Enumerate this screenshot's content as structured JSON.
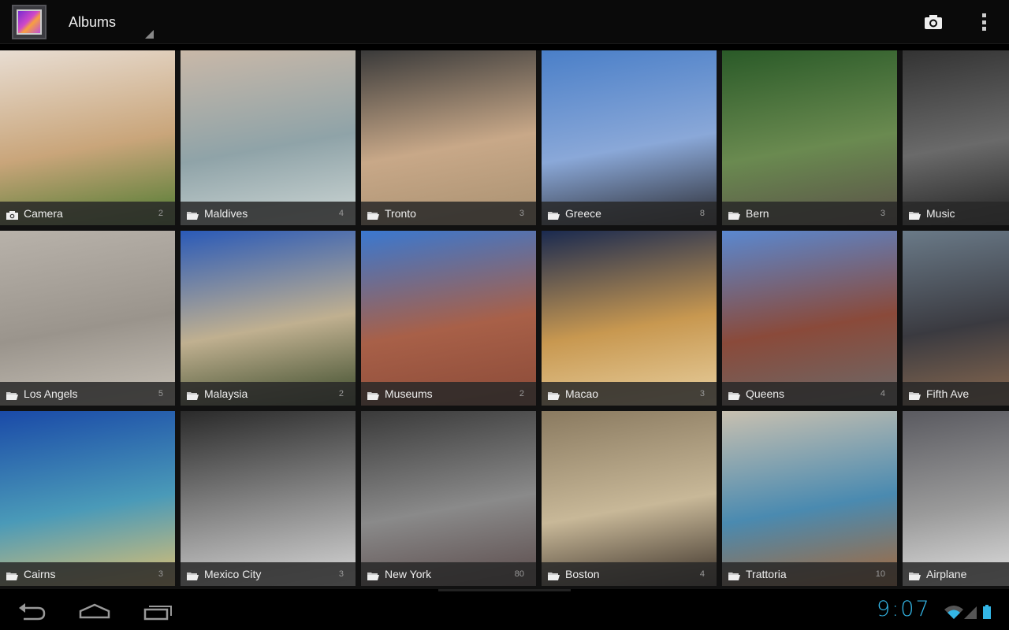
{
  "actionbar": {
    "title": "Albums"
  },
  "status": {
    "time": "9:07"
  },
  "albums": [
    {
      "name": "Camera",
      "count": "2",
      "icon": "camera-icon",
      "colors": [
        "#e8ddd2",
        "#c9a57a",
        "#4d7a30"
      ]
    },
    {
      "name": "Maldives",
      "count": "4",
      "icon": "folder-icon",
      "colors": [
        "#c9b8a8",
        "#8fa3a8",
        "#cfd8d6"
      ]
    },
    {
      "name": "Tronto",
      "count": "3",
      "icon": "folder-icon",
      "colors": [
        "#3a3a3a",
        "#c8a888",
        "#a89070"
      ]
    },
    {
      "name": "Greece",
      "count": "8",
      "icon": "folder-icon",
      "colors": [
        "#4a7fc8",
        "#8aa8d8",
        "#2a2a30"
      ]
    },
    {
      "name": "Bern",
      "count": "3",
      "icon": "folder-icon",
      "colors": [
        "#2a5a28",
        "#6a8a50",
        "#5a5048"
      ]
    },
    {
      "name": "Music",
      "count": "",
      "icon": "folder-icon",
      "colors": [
        "#333",
        "#6a6a6a",
        "#222"
      ]
    },
    {
      "name": "Los Angels",
      "count": "5",
      "icon": "folder-icon",
      "colors": [
        "#b8b2aa",
        "#9a948c",
        "#c8c2b8"
      ]
    },
    {
      "name": "Malaysia",
      "count": "2",
      "icon": "folder-icon",
      "colors": [
        "#2a5ab8",
        "#c0b090",
        "#3a4a2a"
      ]
    },
    {
      "name": "Museums",
      "count": "2",
      "icon": "folder-icon",
      "colors": [
        "#3a78d0",
        "#a86048",
        "#8a4a38"
      ]
    },
    {
      "name": "Macao",
      "count": "3",
      "icon": "folder-icon",
      "colors": [
        "#1a2a50",
        "#c89850",
        "#e8d0a0"
      ]
    },
    {
      "name": "Queens",
      "count": "4",
      "icon": "folder-icon",
      "colors": [
        "#5a88d0",
        "#8a4a3a",
        "#6a6a6a"
      ]
    },
    {
      "name": "Fifth Ave",
      "count": "",
      "icon": "folder-icon",
      "colors": [
        "#6a7a88",
        "#3a3a40",
        "#8a6a50"
      ]
    },
    {
      "name": "Cairns",
      "count": "3",
      "icon": "folder-icon",
      "colors": [
        "#1a4aa8",
        "#4a9ab8",
        "#e0c070"
      ]
    },
    {
      "name": "Mexico City",
      "count": "3",
      "icon": "folder-icon",
      "colors": [
        "#2a2a2a",
        "#8a8a8a",
        "#d8d8d8"
      ]
    },
    {
      "name": "New York",
      "count": "80",
      "icon": "folder-icon",
      "colors": [
        "#3a3a3a",
        "#8a8a8a",
        "#5a4a4a"
      ]
    },
    {
      "name": "Boston",
      "count": "4",
      "icon": "folder-icon",
      "colors": [
        "#8a7a60",
        "#c8b898",
        "#3a3028"
      ]
    },
    {
      "name": "Trattoria",
      "count": "10",
      "icon": "folder-icon",
      "colors": [
        "#c8c0b0",
        "#4a8ab0",
        "#a86838"
      ]
    },
    {
      "name": "Airplane",
      "count": "",
      "icon": "folder-icon",
      "colors": [
        "#5a5a60",
        "#9a9a9a",
        "#e0e0e0"
      ]
    }
  ]
}
